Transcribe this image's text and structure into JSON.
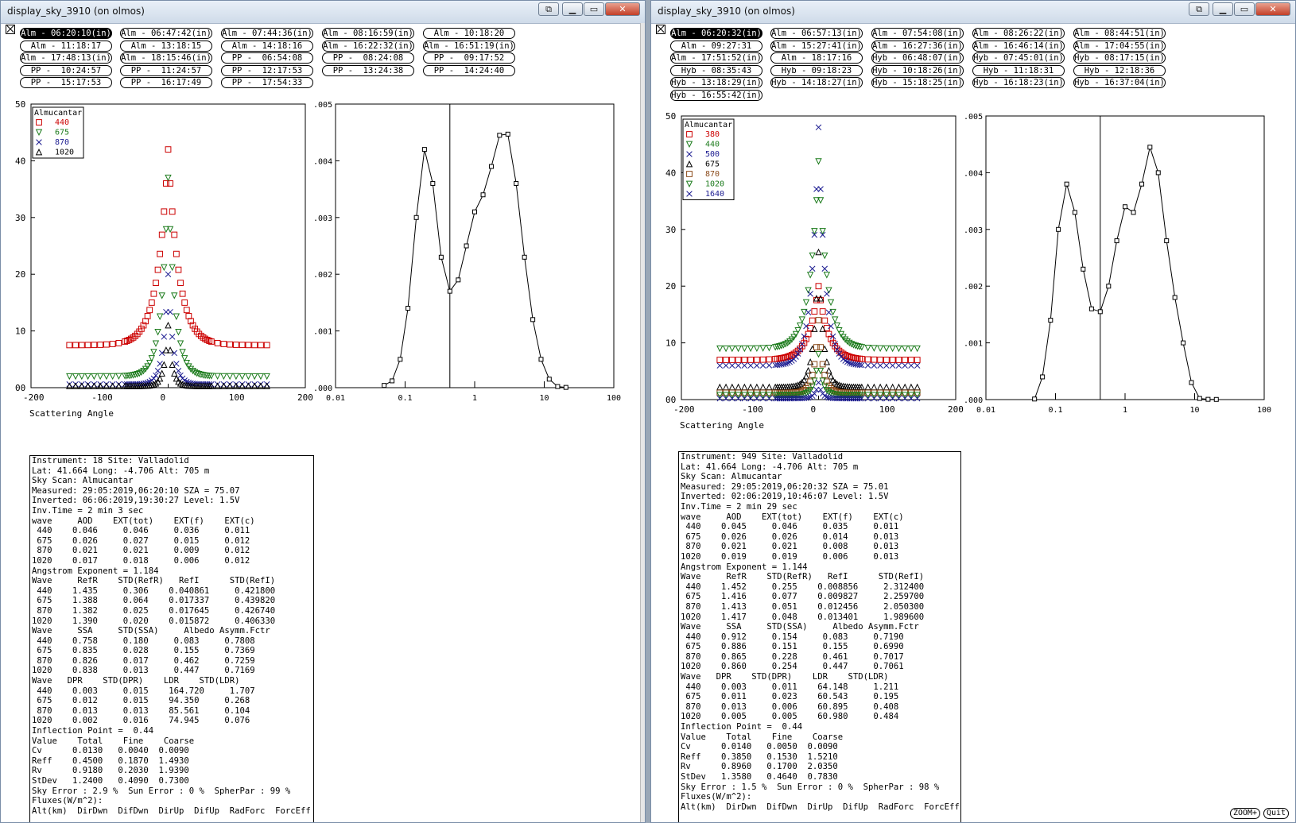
{
  "windows": [
    {
      "title": "display_sky_3910 (on olmos)",
      "scans": [
        {
          "label": "Alm - 06:20:10(in)",
          "selected": true
        },
        {
          "label": "Alm - 06:47:42(in)"
        },
        {
          "label": "Alm - 07:44:36(in)"
        },
        {
          "label": "Alm - 08:16:59(in)"
        },
        {
          "label": "Alm - 10:18:20"
        },
        {
          "label": "Alm - 11:18:17"
        },
        {
          "label": "Alm - 13:18:15"
        },
        {
          "label": "Alm - 14:18:16"
        },
        {
          "label": "Alm - 16:22:32(in)"
        },
        {
          "label": "Alm - 16:51:19(in)"
        },
        {
          "label": "Alm - 17:48:13(in)"
        },
        {
          "label": "Alm - 18:15:46(in)"
        },
        {
          "label": "PP -  06:54:08"
        },
        {
          "label": "PP -  08:24:08"
        },
        {
          "label": "PP -  09:17:52"
        },
        {
          "label": "PP -  10:24:57"
        },
        {
          "label": "PP -  11:24:57"
        },
        {
          "label": "PP -  12:17:53"
        },
        {
          "label": "PP -  13:24:38"
        },
        {
          "label": "PP -  14:24:40"
        },
        {
          "label": "PP -  15:17:53"
        },
        {
          "label": "PP -  16:17:49"
        },
        {
          "label": "PP -  17:54:33"
        }
      ],
      "chart_data": [
        {
          "type": "scatter",
          "title": "",
          "xlabel": "Scattering Angle",
          "ylabel": "",
          "xlim": [
            -200,
            200
          ],
          "ylim": [
            0,
            50
          ],
          "xticks": [
            "-200",
            "-100",
            "0",
            "100",
            "200"
          ],
          "yticks": [
            "00",
            "10",
            "20",
            "30",
            "40",
            "50"
          ],
          "legend_title": "Almucantar",
          "legend_position": "top-left",
          "series": [
            {
              "name": "440",
              "color": "#cc0000",
              "marker": "square",
              "peak": 42,
              "wing": 7.5,
              "width": 22
            },
            {
              "name": "675",
              "color": "#1a7a1a",
              "marker": "triangle-down",
              "peak": 37,
              "wing": 2.0,
              "width": 14
            },
            {
              "name": "870",
              "color": "#1a1a90",
              "marker": "x",
              "peak": 20,
              "wing": 0.6,
              "width": 10
            },
            {
              "name": "1020",
              "color": "#000000",
              "marker": "triangle-up",
              "peak": 11,
              "wing": 0.3,
              "width": 8
            }
          ]
        },
        {
          "type": "line",
          "title": "",
          "xlabel": "",
          "ylabel": "",
          "xscale": "log",
          "xlim": [
            0.01,
            100
          ],
          "ylim": [
            0,
            0.005
          ],
          "xticks": [
            "0.01",
            "0.1",
            "1",
            "10",
            "100"
          ],
          "yticks": [
            "0.000",
            "0.001",
            "0.002",
            "0.003",
            "0.004",
            "0.005"
          ],
          "inflection_point": 0.44,
          "x": [
            0.05,
            0.065,
            0.085,
            0.11,
            0.145,
            0.19,
            0.25,
            0.33,
            0.44,
            0.58,
            0.76,
            1.0,
            1.32,
            1.74,
            2.28,
            3.0,
            3.95,
            5.2,
            6.85,
            9.0,
            11.8,
            15.6,
            20.5
          ],
          "y": [
            4e-05,
            0.00012,
            0.0005,
            0.0014,
            0.003,
            0.0042,
            0.0036,
            0.0023,
            0.0017,
            0.0019,
            0.0025,
            0.0031,
            0.0034,
            0.0039,
            0.00445,
            0.00447,
            0.0036,
            0.0023,
            0.0012,
            0.0005,
            0.00015,
            2e-05,
            5e-06
          ],
          "color": "#000000"
        }
      ],
      "info": [
        "Instrument: 18 Site: Valladolid",
        "Lat: 41.664 Long: -4.706 Alt: 705 m",
        "Sky Scan: Almucantar",
        "Measured: 29:05:2019,06:20:10 SZA = 75.07",
        "Inverted: 06:06:2019,19:30:27 Level: 1.5V",
        "Inv.Time = 2 min 3 sec",
        "wave     AOD    EXT(tot)    EXT(f)    EXT(c)",
        " 440    0.046     0.046     0.036     0.011",
        " 675    0.026     0.027     0.015     0.012",
        " 870    0.021     0.021     0.009     0.012",
        "1020    0.017     0.018     0.006     0.012",
        "Angstrom Exponent = 1.184",
        "Wave     RefR    STD(RefR)   RefI      STD(RefI)",
        " 440    1.435     0.306    0.040861     0.421800",
        " 675    1.388     0.064    0.017337     0.439820",
        " 870    1.382     0.025    0.017645     0.426740",
        "1020    1.390     0.020    0.015872     0.406330",
        "Wave     SSA     STD(SSA)     Albedo Asymm.Fctr",
        " 440    0.758     0.180     0.083     0.7808",
        " 675    0.835     0.028     0.155     0.7369",
        " 870    0.826     0.017     0.462     0.7259",
        "1020    0.838     0.013     0.447     0.7169",
        "Wave   DPR    STD(DPR)    LDR    STD(LDR)",
        " 440    0.003     0.015    164.720     1.707",
        " 675    0.012     0.015    94.350     0.268",
        " 870    0.013     0.013    85.561     0.104",
        "1020    0.002     0.016    74.945     0.076",
        "Inflection Point =  0.44",
        "Value    Total    Fine    Coarse",
        "Cv      0.0130   0.0040  0.0090",
        "Reff    0.4500   0.1870  1.4930",
        "Rv      0.9180   0.2030  1.9390",
        "StDev   1.2400   0.4090  0.7300",
        "Sky Error : 2.9 %  Sun Error : 0 %  SpherPar : 99 %",
        "Fluxes(W/m^2):",
        "Alt(km)  DirDwn  DifDwn  DirUp  DifUp  RadForc  ForcEff"
      ]
    },
    {
      "title": "display_sky_3910 (on olmos)",
      "scans": [
        {
          "label": "Alm - 06:20:32(in)",
          "selected": true
        },
        {
          "label": "Alm - 06:57:13(in)"
        },
        {
          "label": "Alm - 07:54:08(in)"
        },
        {
          "label": "Alm - 08:26:22(in)"
        },
        {
          "label": "Alm - 08:44:51(in)"
        },
        {
          "label": "Alm - 09:27:31"
        },
        {
          "label": "Alm - 15:27:41(in)"
        },
        {
          "label": "Alm - 16:27:36(in)"
        },
        {
          "label": "Alm - 16:46:14(in)"
        },
        {
          "label": "Alm - 17:04:55(in)"
        },
        {
          "label": "Alm - 17:51:52(in)"
        },
        {
          "label": "Alm - 18:17:16"
        },
        {
          "label": "Hyb - 06:48:07(in)"
        },
        {
          "label": "Hyb - 07:45:01(in)"
        },
        {
          "label": "Hyb - 08:17:15(in)"
        },
        {
          "label": "Hyb - 08:35:43"
        },
        {
          "label": "Hyb - 09:18:23"
        },
        {
          "label": "Hyb - 10:18:26(in)"
        },
        {
          "label": "Hyb - 11:18:31"
        },
        {
          "label": "Hyb - 12:18:36"
        },
        {
          "label": "Hyb - 13:18:29(in)"
        },
        {
          "label": "Hyb - 14:18:27(in)"
        },
        {
          "label": "Hyb - 15:18:25(in)"
        },
        {
          "label": "Hyb - 16:18:23(in)"
        },
        {
          "label": "Hyb - 16:37:04(in)"
        },
        {
          "label": "Hyb - 16:55:42(in)"
        }
      ],
      "chart_data": [
        {
          "type": "scatter",
          "title": "",
          "xlabel": "Scattering Angle",
          "ylabel": "",
          "xlim": [
            -200,
            200
          ],
          "ylim": [
            0,
            50
          ],
          "xticks": [
            "-200",
            "-100",
            "0",
            "100",
            "200"
          ],
          "yticks": [
            "00",
            "10",
            "20",
            "30",
            "40",
            "50"
          ],
          "legend_title": "Almucantar",
          "legend_position": "top-left",
          "series": [
            {
              "name": "380",
              "color": "#cc0000",
              "marker": "square",
              "peak": 20,
              "wing": 7,
              "width": 20
            },
            {
              "name": "440",
              "color": "#1a7a1a",
              "marker": "triangle-down",
              "peak": 42,
              "wing": 9,
              "width": 18
            },
            {
              "name": "500",
              "color": "#1a1a90",
              "marker": "x",
              "peak": 48,
              "wing": 6,
              "width": 14
            },
            {
              "name": "675",
              "color": "#000000",
              "marker": "triangle-up",
              "peak": 26,
              "wing": 2.2,
              "width": 10
            },
            {
              "name": "870",
              "color": "#8a4a1a",
              "marker": "square",
              "peak": 14,
              "wing": 1.2,
              "width": 9
            },
            {
              "name": "1020",
              "color": "#1a7a1a",
              "marker": "triangle-down",
              "peak": 8,
              "wing": 0.8,
              "width": 8
            },
            {
              "name": "1640",
              "color": "#1a1a90",
              "marker": "x",
              "peak": 3,
              "wing": 0.2,
              "width": 7
            }
          ]
        },
        {
          "type": "line",
          "title": "",
          "xlabel": "",
          "ylabel": "",
          "xscale": "log",
          "xlim": [
            0.01,
            100
          ],
          "ylim": [
            0,
            0.005
          ],
          "xticks": [
            "0.01",
            "0.1",
            "1",
            "10",
            "100"
          ],
          "yticks": [
            "0.000",
            "0.001",
            "0.002",
            "0.003",
            "0.004",
            "0.005"
          ],
          "inflection_point": 0.44,
          "x": [
            0.05,
            0.065,
            0.085,
            0.11,
            0.145,
            0.19,
            0.25,
            0.33,
            0.44,
            0.58,
            0.76,
            1.0,
            1.32,
            1.74,
            2.28,
            3.0,
            3.95,
            5.2,
            6.85,
            9.0,
            11.8,
            15.6,
            20.5
          ],
          "y": [
            1e-05,
            0.0004,
            0.0014,
            0.003,
            0.0038,
            0.0033,
            0.0023,
            0.0016,
            0.00155,
            0.002,
            0.0028,
            0.0034,
            0.0033,
            0.0038,
            0.00445,
            0.004,
            0.0028,
            0.0018,
            0.001,
            0.0003,
            2e-05,
            5e-06,
            3e-06
          ],
          "color": "#000000"
        }
      ],
      "info": [
        "Instrument: 949 Site: Valladolid",
        "Lat: 41.664 Long: -4.706 Alt: 705 m",
        "Sky Scan: Almucantar",
        "Measured: 29:05:2019,06:20:32 SZA = 75.01",
        "Inverted: 02:06:2019,10:46:07 Level: 1.5V",
        "Inv.Time = 2 min 29 sec",
        "wave     AOD    EXT(tot)    EXT(f)    EXT(c)",
        " 440    0.045     0.046     0.035     0.011",
        " 675    0.026     0.026     0.014     0.013",
        " 870    0.021     0.021     0.008     0.013",
        "1020    0.019     0.019     0.006     0.013",
        "Angstrom Exponent = 1.144",
        "Wave     RefR    STD(RefR)   RefI      STD(RefI)",
        " 440    1.452     0.255    0.008856     2.312400",
        " 675    1.416     0.077    0.009827     2.259700",
        " 870    1.413     0.051    0.012456     2.050300",
        "1020    1.417     0.048    0.013401     1.989600",
        "Wave     SSA     STD(SSA)     Albedo Asymm.Fctr",
        " 440    0.912     0.154     0.083     0.7190",
        " 675    0.886     0.151     0.155     0.6990",
        " 870    0.865     0.228     0.461     0.7017",
        "1020    0.860     0.254     0.447     0.7061",
        "Wave   DPR    STD(DPR)    LDR    STD(LDR)",
        " 440    0.003     0.011    64.148     1.211",
        " 675    0.011     0.023    60.543     0.195",
        " 870    0.013     0.006    60.895     0.408",
        "1020    0.005     0.005    60.980     0.484",
        "Inflection Point =  0.44",
        "Value    Total    Fine    Coarse",
        "Cv      0.0140   0.0050  0.0090",
        "Reff    0.3850   0.1530  1.5210",
        "Rv      0.8960   0.1700  2.0350",
        "StDev   1.3580   0.4640  0.7830",
        "Sky Error : 1.5 %  Sun Error : 0 %  SpherPar : 98 %",
        "Fluxes(W/m^2):",
        "Alt(km)  DirDwn  DifDwn  DirUp  DifUp  RadForc  ForcEff"
      ],
      "extra_buttons": {
        "zoom": "ZOOM+",
        "quit": "Quit"
      }
    }
  ]
}
